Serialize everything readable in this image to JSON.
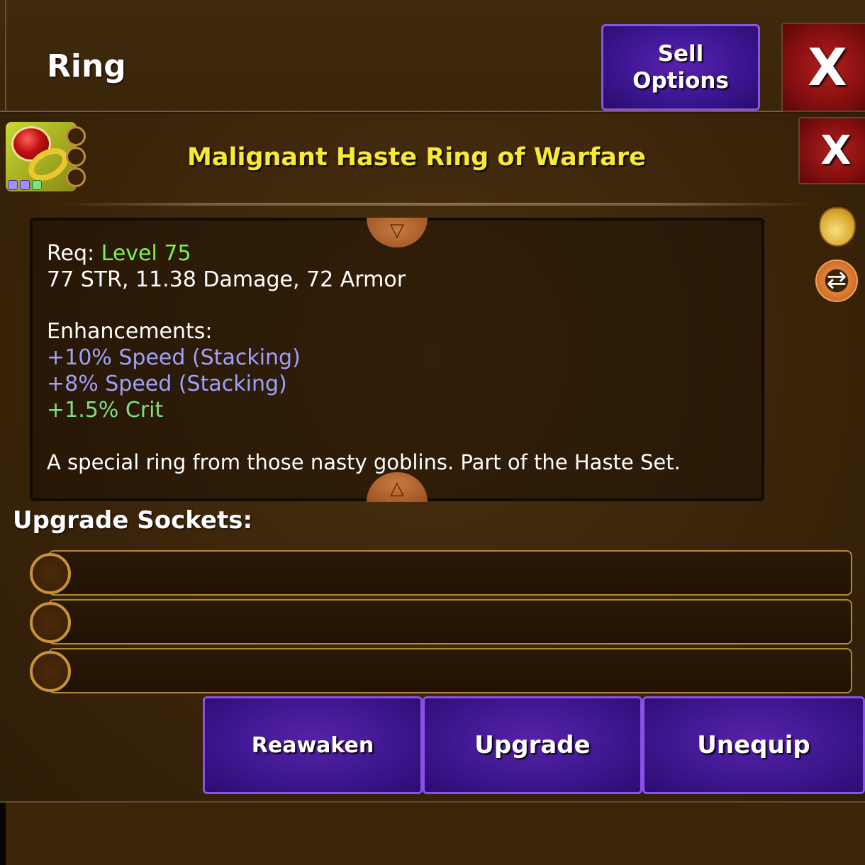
{
  "header": {
    "title": "Ring",
    "sell_label_line1": "Sell",
    "sell_label_line2": "Options",
    "close_label": "X"
  },
  "item": {
    "name": "Malignant Haste Ring of Warfare",
    "close_label": "X",
    "req_prefix": "Req:",
    "req_level": "Level 75",
    "stats": "77 STR, 11.38 Damage, 72 Armor",
    "enhancements_title": "Enhancements:",
    "enhancements": [
      {
        "text": "+10% Speed (Stacking)",
        "color": "#a0a0ff"
      },
      {
        "text": "+8% Speed (Stacking)",
        "color": "#a0a0ff"
      },
      {
        "text": "+1.5% Crit",
        "color": "#80e080"
      }
    ],
    "description": "A special ring from those nasty goblins. Part of the Haste Set."
  },
  "sockets": {
    "title": "Upgrade Sockets:",
    "count": 3
  },
  "actions": {
    "reawaken": "Reawaken",
    "upgrade": "Upgrade",
    "unequip": "Unequip"
  },
  "colors": {
    "item_name": "#f8e838",
    "level": "#80f050",
    "button": "#3e1790",
    "close": "#8a1010"
  }
}
